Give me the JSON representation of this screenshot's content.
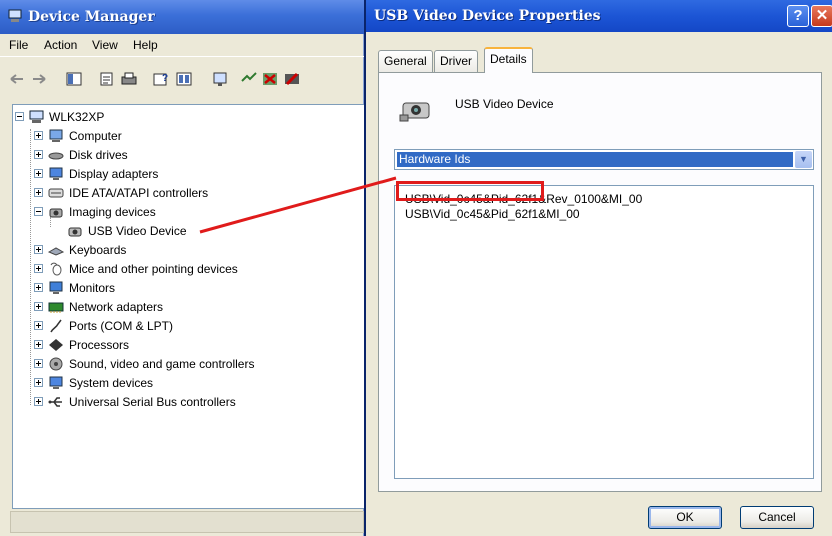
{
  "device_manager": {
    "title": "Device Manager",
    "menu": [
      "File",
      "Action",
      "View",
      "Help"
    ],
    "toolbar_icons": [
      "back-icon",
      "forward-icon",
      "console-tree-icon",
      "properties-icon",
      "print-icon",
      "help-icon",
      "details-view-icon",
      "scan-hardware-icon",
      "update-driver-icon",
      "uninstall-icon",
      "disable-icon"
    ],
    "tree": {
      "root": "WLK32XP",
      "categories": [
        {
          "label": "Computer",
          "icon": "computer-icon",
          "expanded": false
        },
        {
          "label": "Disk drives",
          "icon": "disk-drive-icon",
          "expanded": false
        },
        {
          "label": "Display adapters",
          "icon": "display-adapter-icon",
          "expanded": false
        },
        {
          "label": "IDE ATA/ATAPI controllers",
          "icon": "ide-controller-icon",
          "expanded": false
        },
        {
          "label": "Imaging devices",
          "icon": "camera-icon",
          "expanded": true,
          "children": [
            "USB Video Device"
          ]
        },
        {
          "label": "Keyboards",
          "icon": "keyboard-icon",
          "expanded": false
        },
        {
          "label": "Mice and other pointing devices",
          "icon": "mouse-icon",
          "expanded": false
        },
        {
          "label": "Monitors",
          "icon": "monitor-icon",
          "expanded": false
        },
        {
          "label": "Network adapters",
          "icon": "network-adapter-icon",
          "expanded": false
        },
        {
          "label": "Ports (COM & LPT)",
          "icon": "port-icon",
          "expanded": false
        },
        {
          "label": "Processors",
          "icon": "processor-icon",
          "expanded": false
        },
        {
          "label": "Sound, video and game controllers",
          "icon": "sound-icon",
          "expanded": false
        },
        {
          "label": "System devices",
          "icon": "system-device-icon",
          "expanded": false
        },
        {
          "label": "Universal Serial Bus controllers",
          "icon": "usb-icon",
          "expanded": false
        }
      ]
    }
  },
  "properties_dialog": {
    "title": "USB Video Device Properties",
    "tabs": [
      "General",
      "Driver",
      "Details"
    ],
    "active_tab": "Details",
    "device_name": "USB Video Device",
    "property_select": "Hardware Ids",
    "values": [
      "USB\\Vid_0c45&Pid_62f1&Rev_0100&MI_00",
      "USB\\Vid_0c45&Pid_62f1&MI_00"
    ],
    "ok_label": "OK",
    "cancel_label": "Cancel"
  },
  "colors": {
    "annotation_red": "#e01b1b",
    "xp_title_blue": "#2d5dc6",
    "selection_blue": "#316ac5"
  }
}
